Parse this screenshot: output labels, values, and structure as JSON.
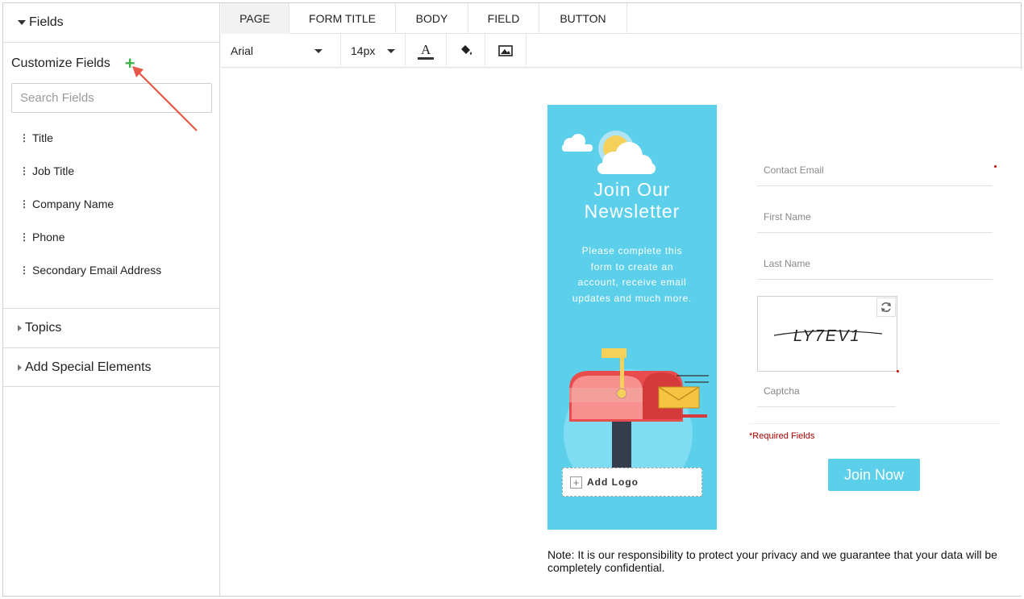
{
  "sidebar": {
    "fields_header": "Fields",
    "customize_label": "Customize Fields",
    "add_symbol": "+",
    "search_placeholder": "Search Fields",
    "items": [
      {
        "label": "Title"
      },
      {
        "label": "Job Title"
      },
      {
        "label": "Company Name"
      },
      {
        "label": "Phone"
      },
      {
        "label": "Secondary Email Address"
      }
    ],
    "topics": "Topics",
    "special": "Add Special Elements"
  },
  "tabs": [
    "PAGE",
    "FORM TITLE",
    "BODY",
    "FIELD",
    "BUTTON"
  ],
  "toolbar": {
    "font": "Arial",
    "size": "14px"
  },
  "banner": {
    "title": "Join Our Newsletter",
    "description": "Please complete this form to create an account, receive email updates and much more.",
    "add_logo": "Add Logo",
    "background": "#5ccfea"
  },
  "form": {
    "fields": [
      {
        "label": "Contact Email"
      },
      {
        "label": "First Name"
      },
      {
        "label": "Last Name"
      }
    ],
    "captcha_text": "LY7EV1",
    "captcha_label": "Captcha",
    "required_note": "*Required Fields",
    "submit": "Join Now"
  },
  "note": "Note: It is our responsibility to protect your privacy and we guarantee that your data will be completely confidential.",
  "colors": {
    "accent": "#5ccfea",
    "plus": "#3db24a",
    "arrow": "#e8574a"
  }
}
